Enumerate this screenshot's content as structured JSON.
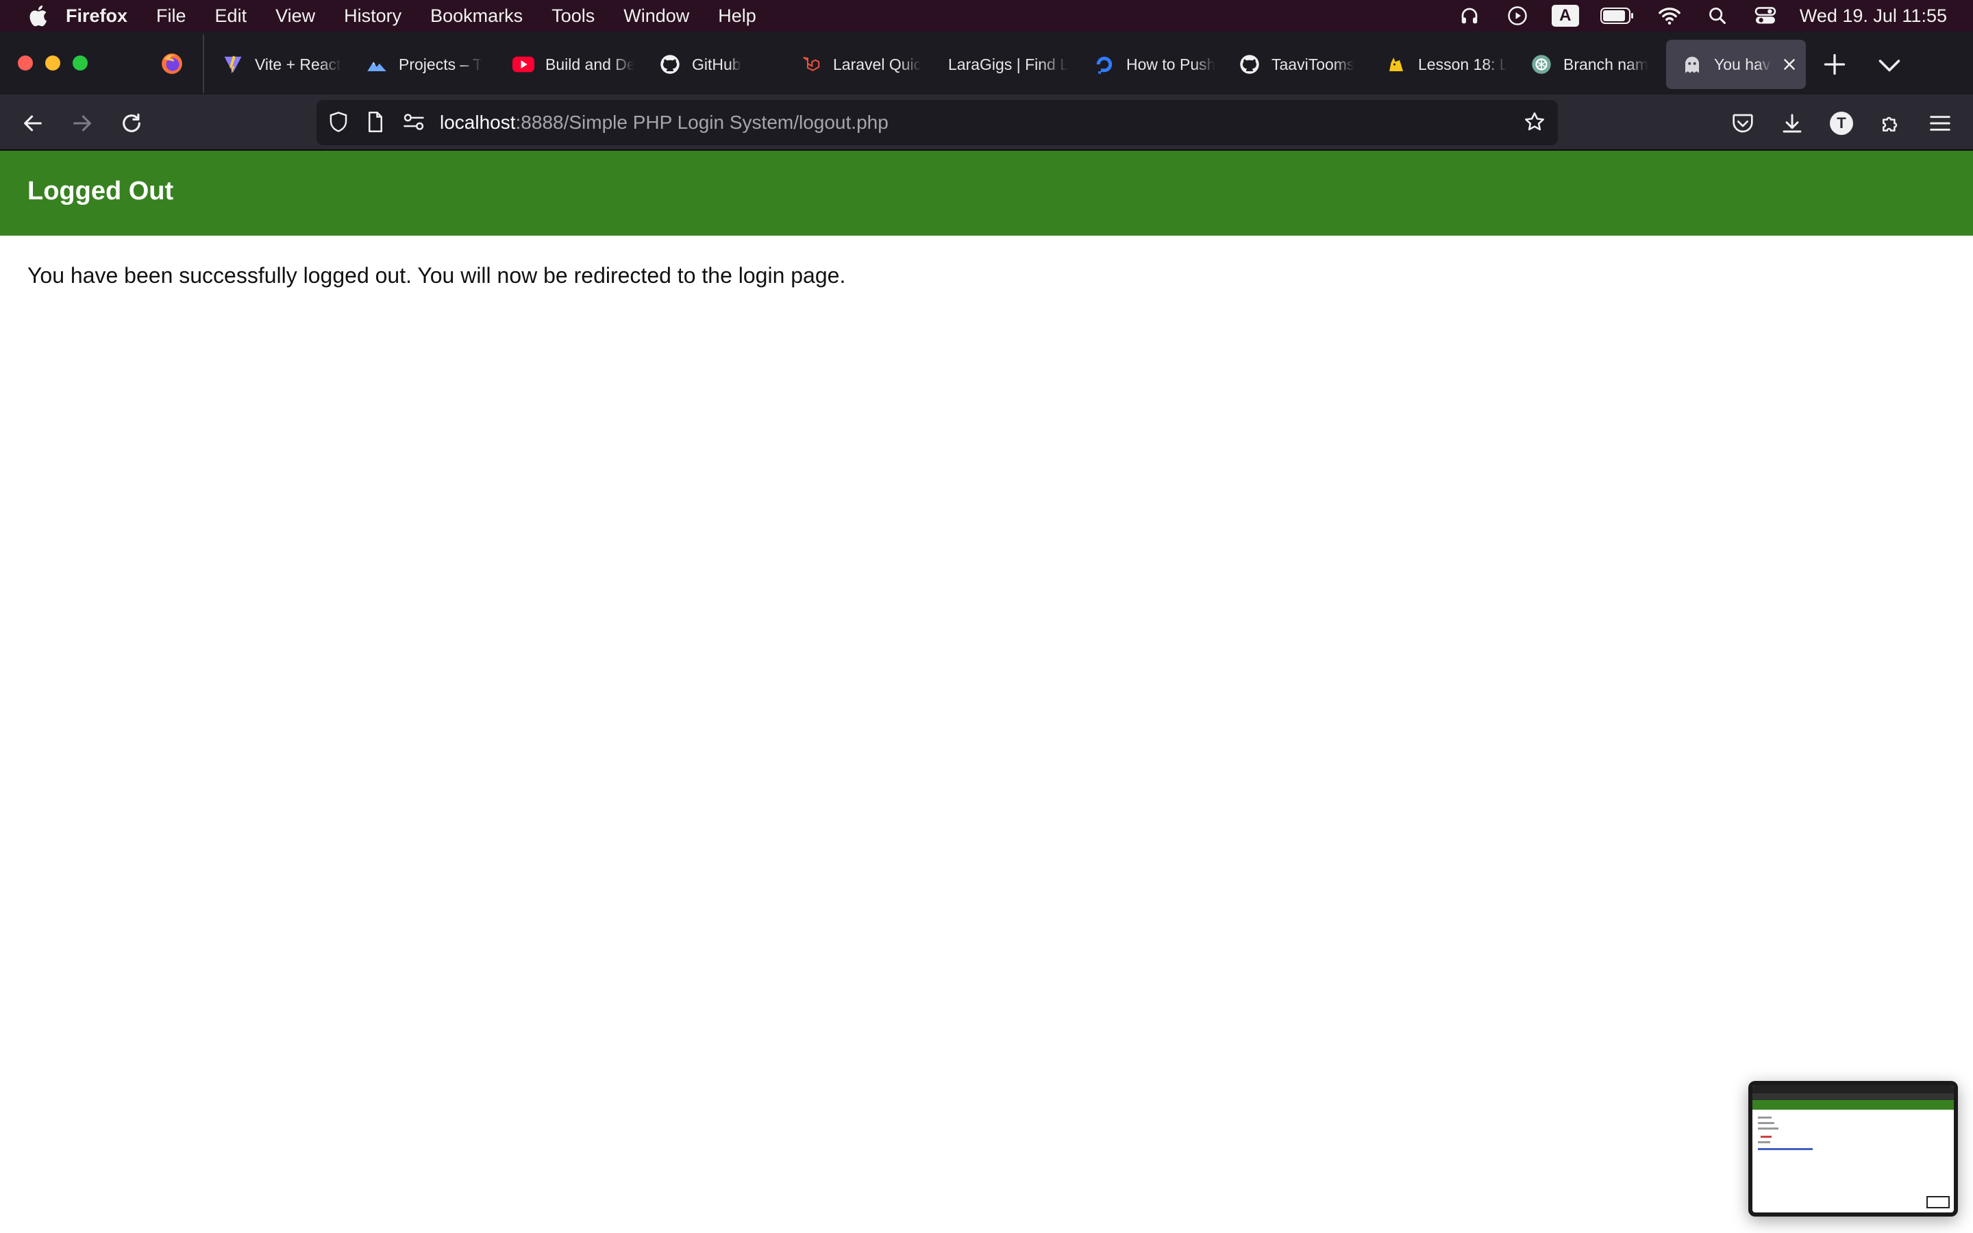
{
  "os_menubar": {
    "app_name": "Firefox",
    "items": [
      "File",
      "Edit",
      "View",
      "History",
      "Bookmarks",
      "Tools",
      "Window",
      "Help"
    ],
    "input_source": "A",
    "clock": "Wed 19. Jul  11:55"
  },
  "tabs": [
    {
      "label": "Vite + React",
      "favicon": "vite-icon"
    },
    {
      "label": "Projects – T",
      "favicon": "mountain-icon"
    },
    {
      "label": "Build and De",
      "favicon": "youtube-icon"
    },
    {
      "label": "GitHub",
      "favicon": "github-icon"
    },
    {
      "label": "Laravel Quic",
      "favicon": "laravel-icon"
    },
    {
      "label": "LaraGigs | Find L",
      "favicon": ""
    },
    {
      "label": "How to Push",
      "favicon": "digitalocean-icon"
    },
    {
      "label": "TaaviTooms",
      "favicon": "github-icon"
    },
    {
      "label": "Lesson 18: L",
      "favicon": "cat-icon"
    },
    {
      "label": "Branch nam",
      "favicon": "chatgpt-icon"
    },
    {
      "label": "You have",
      "favicon": "ghost-icon",
      "active": true
    }
  ],
  "navbar": {
    "url_host": "localhost",
    "url_path": ":8888/Simple PHP Login System/logout.php",
    "account_initial": "T"
  },
  "page": {
    "header_title": "Logged Out",
    "message": "You have been successfully logged out. You will now be redirected to the login page.",
    "header_color": "#388121"
  }
}
